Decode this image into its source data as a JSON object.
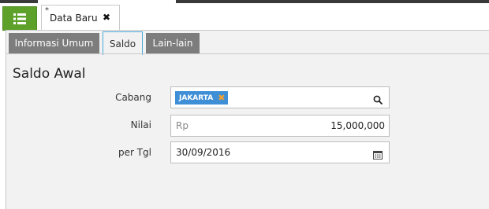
{
  "document_tab": {
    "modified_mark": "*",
    "title": "Data Baru",
    "close_glyph": "✖"
  },
  "menu_button": {
    "icon": "list-menu-icon",
    "color": "#5ea12a"
  },
  "tabs": [
    {
      "label": "Informasi Umum",
      "active": false
    },
    {
      "label": "Saldo",
      "active": true
    },
    {
      "label": "Lain-lain",
      "active": false
    }
  ],
  "section": {
    "title": "Saldo Awal"
  },
  "form": {
    "cabang": {
      "label": "Cabang",
      "chip": "JAKARTA",
      "chip_remove_glyph": "✖",
      "icon": "search-icon"
    },
    "nilai": {
      "label": "Nilai",
      "currency": "Rp",
      "value": "15,000,000"
    },
    "per_tgl": {
      "label": "per Tgl",
      "value": "30/09/2016",
      "icon": "calendar-icon"
    }
  },
  "colors": {
    "active_tab_border": "#4aa8d8",
    "chip": "#3f8fd6",
    "inactive_tab": "#7d7d7d"
  }
}
